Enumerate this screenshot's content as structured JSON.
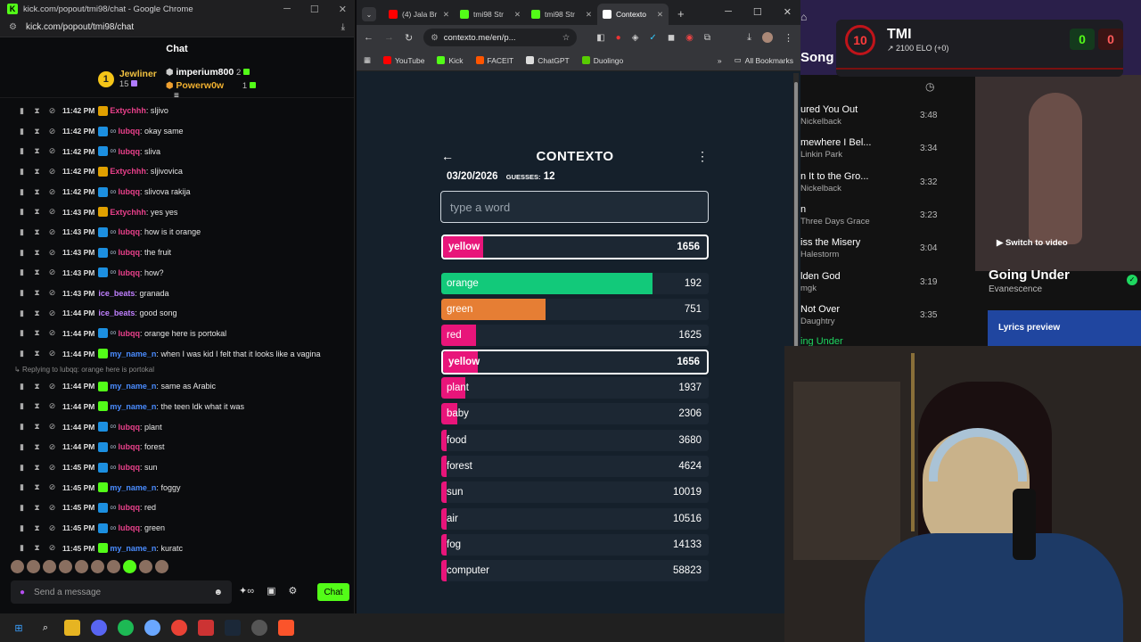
{
  "chat_window": {
    "title": "kick.com/popout/tmi98/chat - Google Chrome",
    "url": "kick.com/popout/tmi98/chat",
    "header": "Chat",
    "leaderboard": [
      {
        "rank": "1",
        "name": "Jewliner",
        "count": "15",
        "color": "#f0c040"
      },
      {
        "name": "imperium800",
        "count": "2",
        "color": "#ffffff"
      },
      {
        "name": "Powerw0w",
        "count": "1",
        "color": "#f0b030"
      }
    ],
    "messages": [
      {
        "time": "11:42 PM",
        "user": "Extychhh",
        "text": "sljivo",
        "color": "#e8408a",
        "badge": "gold"
      },
      {
        "time": "11:42 PM",
        "user": "lubqq",
        "text": "okay same",
        "color": "#e8408a",
        "badge": "blue"
      },
      {
        "time": "11:42 PM",
        "user": "lubqq",
        "text": "sliva",
        "color": "#e8408a",
        "badge": "blue"
      },
      {
        "time": "11:42 PM",
        "user": "Extychhh",
        "text": "sljivovica",
        "color": "#e8408a",
        "badge": "gold"
      },
      {
        "time": "11:42 PM",
        "user": "lubqq",
        "text": "slivova rakija",
        "color": "#e8408a",
        "badge": "blue"
      },
      {
        "time": "11:43 PM",
        "user": "Extychhh",
        "text": "yes yes",
        "color": "#e8408a",
        "badge": "gold"
      },
      {
        "time": "11:43 PM",
        "user": "lubqq",
        "text": "how is it orange",
        "color": "#e8408a",
        "badge": "blue"
      },
      {
        "time": "11:43 PM",
        "user": "lubqq",
        "text": "the fruit",
        "color": "#e8408a",
        "badge": "blue"
      },
      {
        "time": "11:43 PM",
        "user": "lubqq",
        "text": "how?",
        "color": "#e8408a",
        "badge": "blue"
      },
      {
        "time": "11:43 PM",
        "user": "ice_beats",
        "text": "granada",
        "color": "#c080ff",
        "badge": ""
      },
      {
        "time": "11:44 PM",
        "user": "ice_beats",
        "text": "good song",
        "color": "#c080ff",
        "badge": ""
      },
      {
        "time": "11:44 PM",
        "user": "lubqq",
        "text": "orange here is portokal",
        "color": "#e8408a",
        "badge": "blue"
      },
      {
        "time": "11:44 PM",
        "user": "my_name_n",
        "text": "when I was kid I felt that it looks like a vagina",
        "color": "#4a8cff",
        "badge": "green"
      }
    ],
    "reply_note": "Replying to lubqq: orange here is portokal",
    "messages2": [
      {
        "time": "11:44 PM",
        "user": "my_name_n",
        "text": "same as Arabic",
        "color": "#4a8cff",
        "badge": "green"
      },
      {
        "time": "11:44 PM",
        "user": "my_name_n",
        "text": "the teen ldk what it was",
        "color": "#4a8cff",
        "badge": "green"
      },
      {
        "time": "11:44 PM",
        "user": "lubqq",
        "text": "plant",
        "color": "#e8408a",
        "badge": "blue"
      },
      {
        "time": "11:44 PM",
        "user": "lubqq",
        "text": "forest",
        "color": "#e8408a",
        "badge": "blue"
      },
      {
        "time": "11:45 PM",
        "user": "lubqq",
        "text": "sun",
        "color": "#e8408a",
        "badge": "blue"
      },
      {
        "time": "11:45 PM",
        "user": "my_name_n",
        "text": "foggy",
        "color": "#4a8cff",
        "badge": "green"
      },
      {
        "time": "11:45 PM",
        "user": "lubqq",
        "text": "red",
        "color": "#e8408a",
        "badge": "blue"
      },
      {
        "time": "11:45 PM",
        "user": "lubqq",
        "text": "green",
        "color": "#e8408a",
        "badge": "blue"
      },
      {
        "time": "11:45 PM",
        "user": "my_name_n",
        "text": "kuratc",
        "color": "#4a8cff",
        "badge": "green"
      }
    ],
    "send_placeholder": "Send a message",
    "send_button": "Chat"
  },
  "browser": {
    "tabs": [
      {
        "label": "(4) Jala Br",
        "color": "#ff0000"
      },
      {
        "label": "tmi98 Str",
        "color": "#53fc18"
      },
      {
        "label": "tmi98 Str",
        "color": "#53fc18"
      },
      {
        "label": "Contexto",
        "color": "#ffffff"
      }
    ],
    "url": "contexto.me/en/p...",
    "bookmarks": [
      {
        "label": "YouTube",
        "color": "#ff0000"
      },
      {
        "label": "Kick",
        "color": "#53fc18"
      },
      {
        "label": "FACEIT",
        "color": "#ff5500"
      },
      {
        "label": "ChatGPT",
        "color": "#dddddd"
      },
      {
        "label": "Duolingo",
        "color": "#58cc02"
      }
    ],
    "all_bookmarks": "All Bookmarks"
  },
  "contexto": {
    "title": "CONTEXTO",
    "date": "03/20/2026",
    "guesses_label": "GUESSES:",
    "guesses": "12",
    "input_placeholder": "type a word",
    "last_guess": {
      "word": "yellow",
      "rank": "1656",
      "fill": 0.15,
      "color": "#e8157a"
    },
    "guesses_list": [
      {
        "word": "orange",
        "rank": "192",
        "fill": 0.79,
        "color": "#12c97a"
      },
      {
        "word": "green",
        "rank": "751",
        "fill": 0.39,
        "color": "#e67e34"
      },
      {
        "word": "red",
        "rank": "1625",
        "fill": 0.13,
        "color": "#e8157a"
      },
      {
        "word": "yellow",
        "rank": "1656",
        "fill": 0.13,
        "color": "#e8157a",
        "highlight": true
      },
      {
        "word": "plant",
        "rank": "1937",
        "fill": 0.09,
        "color": "#e8157a"
      },
      {
        "word": "baby",
        "rank": "2306",
        "fill": 0.06,
        "color": "#e8157a"
      },
      {
        "word": "food",
        "rank": "3680",
        "fill": 0.01,
        "color": "#e8157a"
      },
      {
        "word": "forest",
        "rank": "4624",
        "fill": 0.01,
        "color": "#e8157a"
      },
      {
        "word": "sun",
        "rank": "10019",
        "fill": 0.01,
        "color": "#e8157a"
      },
      {
        "word": "air",
        "rank": "10516",
        "fill": 0.01,
        "color": "#e8157a"
      },
      {
        "word": "fog",
        "rank": "14133",
        "fill": 0.01,
        "color": "#e8157a"
      },
      {
        "word": "computer",
        "rank": "58823",
        "fill": 0.01,
        "color": "#e8157a"
      }
    ]
  },
  "spotify": {
    "header": "Song",
    "tracks": [
      {
        "title": "ured You Out",
        "artist": "Nickelback",
        "duration": "3:48"
      },
      {
        "title": "mewhere I Bel...",
        "artist": "Linkin Park",
        "duration": "3:34"
      },
      {
        "title": "n It to the Gro...",
        "artist": "Nickelback",
        "duration": "3:32"
      },
      {
        "title": "n",
        "artist": "Three Days Grace",
        "duration": "3:23"
      },
      {
        "title": "iss the Misery",
        "artist": "Halestorm",
        "duration": "3:04"
      },
      {
        "title": "lden God",
        "artist": "mgk",
        "duration": "3:19"
      },
      {
        "title": "Not Over",
        "artist": "Daughtry",
        "duration": "3:35"
      }
    ],
    "next_partial": "ing Under",
    "switch_video": "Switch to video",
    "now_title": "Going Under",
    "now_artist": "Evanescence",
    "lyrics": "Lyrics preview"
  },
  "faceit": {
    "level": "10",
    "name": "TMI",
    "elo": "2100 ELO (+0)",
    "score_a": "0",
    "score_b": "0"
  }
}
